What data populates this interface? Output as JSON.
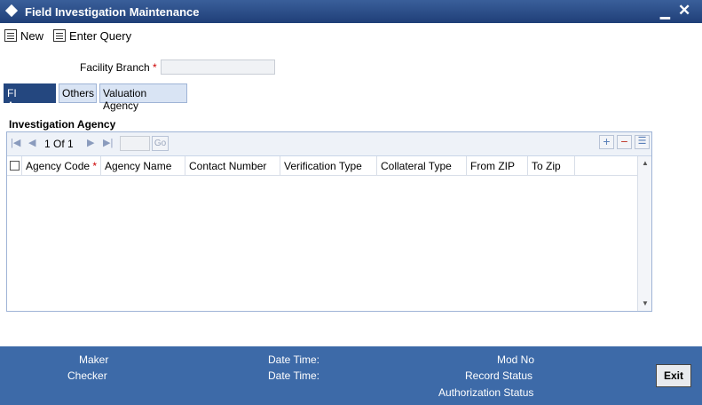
{
  "window": {
    "title": "Field Investigation Maintenance",
    "minimize_glyph": "▁",
    "close_glyph": "✕"
  },
  "toolbar": {
    "new_label": "New",
    "enter_query_label": "Enter Query"
  },
  "form": {
    "facility_branch_label": "Facility Branch",
    "required_marker": "*",
    "facility_branch_value": ""
  },
  "tabs": [
    {
      "label": "FI Agency",
      "active": true
    },
    {
      "label": "Others",
      "active": false
    },
    {
      "label": "Valuation Agency",
      "active": false
    }
  ],
  "section": {
    "title": "Investigation Agency"
  },
  "pager": {
    "first": "|◀",
    "prev": "◀",
    "page_text": "1 Of 1",
    "next": "▶",
    "last": "▶|",
    "page_value": "",
    "go_label": "Go"
  },
  "grid_tools": {
    "add": "+",
    "remove": "−",
    "details": "☰"
  },
  "columns": [
    {
      "label": "Agency Code",
      "required": true
    },
    {
      "label": "Agency Name"
    },
    {
      "label": "Contact Number"
    },
    {
      "label": "Verification Type"
    },
    {
      "label": "Collateral Type"
    },
    {
      "label": "From ZIP"
    },
    {
      "label": "To Zip"
    }
  ],
  "rows": [],
  "footer": {
    "maker": "Maker",
    "checker": "Checker",
    "date_time_1": "Date Time:",
    "date_time_2": "Date Time:",
    "mod_no": "Mod No",
    "record_status": "Record Status",
    "authorization_status": "Authorization Status",
    "exit_label": "Exit"
  },
  "colors": {
    "titlebar": "#24477f",
    "footer": "#3d6aa8",
    "active_tab": "#24477f",
    "required": "#cc0000"
  },
  "icons": {
    "new": "new-document-icon",
    "enter_query": "query-icon",
    "title": "diamond-icon"
  }
}
